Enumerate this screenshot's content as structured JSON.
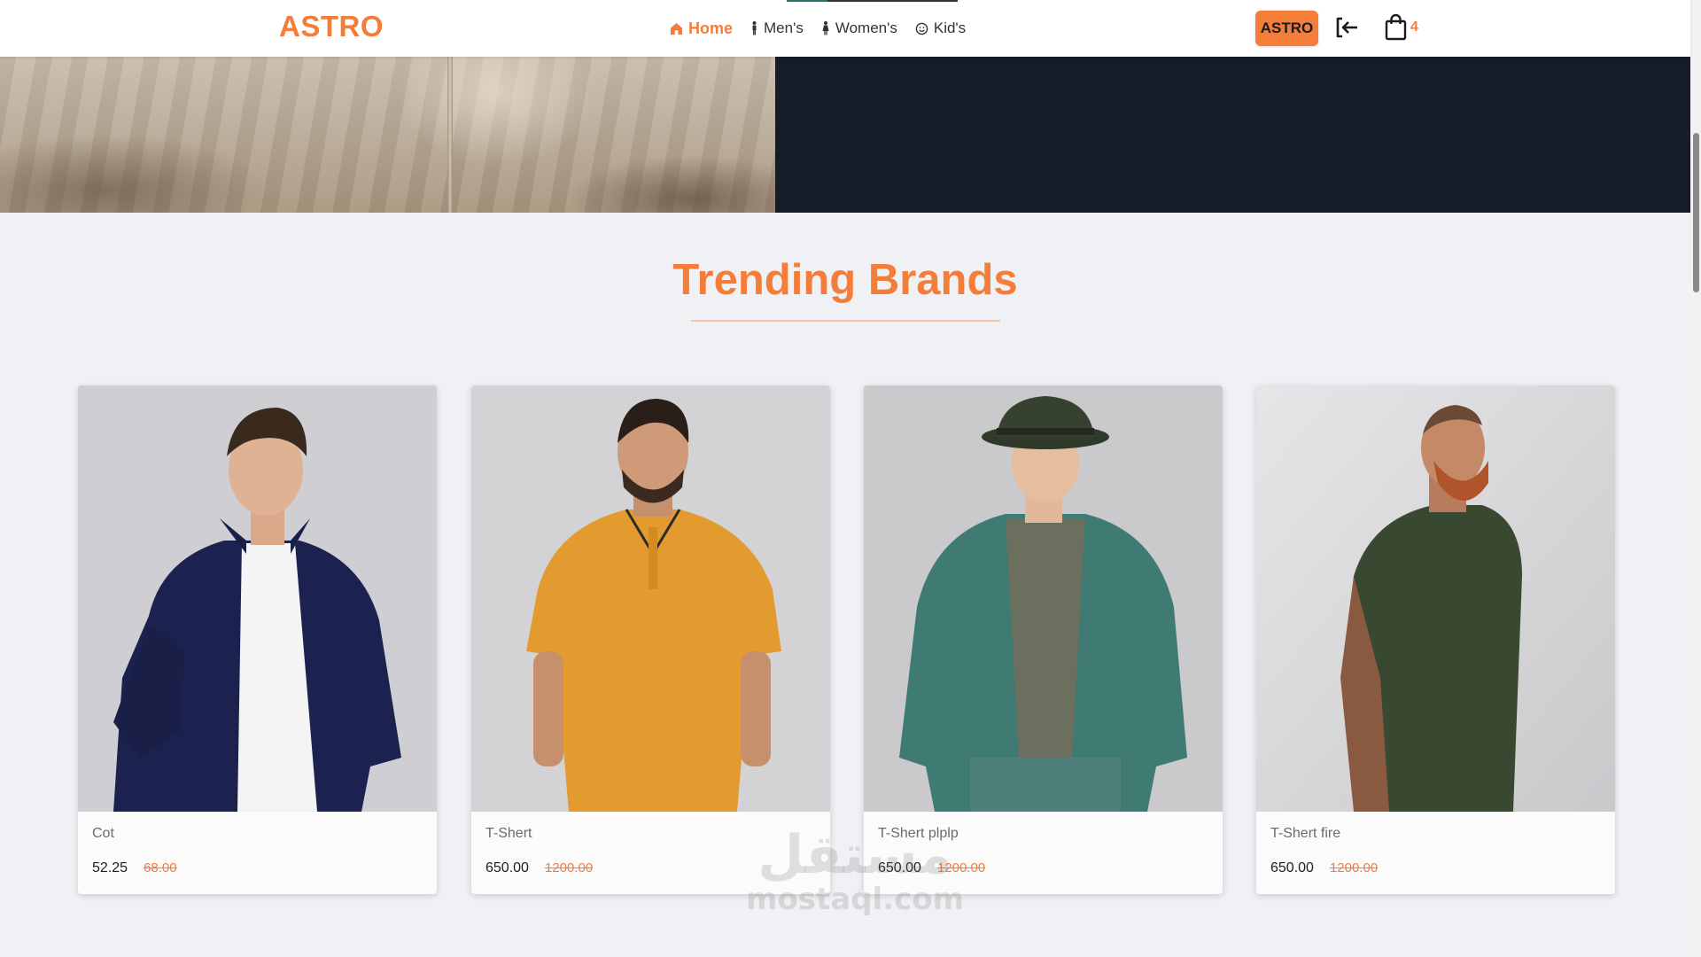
{
  "header": {
    "brand": "ASTRO",
    "nav": [
      {
        "label": "Home",
        "icon": "home-icon",
        "active": true
      },
      {
        "label": "Men's",
        "icon": "man-icon",
        "active": false
      },
      {
        "label": "Women's",
        "icon": "woman-icon",
        "active": false
      },
      {
        "label": "Kid's",
        "icon": "smile-icon",
        "active": false
      }
    ],
    "user_button": "ASTRO",
    "logout_icon": "logout-icon",
    "cart_icon": "shopping-bag-icon",
    "cart_count": "4"
  },
  "colors": {
    "accent": "#f47d3a",
    "hero_dark": "#171c29",
    "page_bg": "#f0f1f4"
  },
  "trending": {
    "title": "Trending Brands",
    "products": [
      {
        "name": "Cot",
        "price": "52.25",
        "old_price": "68.00",
        "image": "man-navy-jacket-photo"
      },
      {
        "name": "T-Shert",
        "price": "650.00",
        "old_price": "1200.00",
        "image": "man-yellow-polo-photo"
      },
      {
        "name": "T-Shert plplp",
        "price": "650.00",
        "old_price": "1200.00",
        "image": "man-denim-jacket-hat-photo"
      },
      {
        "name": "T-Shert fire",
        "price": "650.00",
        "old_price": "1200.00",
        "image": "man-green-tshirt-beard-photo"
      }
    ]
  },
  "watermark": {
    "arabic": "مستقل",
    "latin": "mostaql.com"
  }
}
